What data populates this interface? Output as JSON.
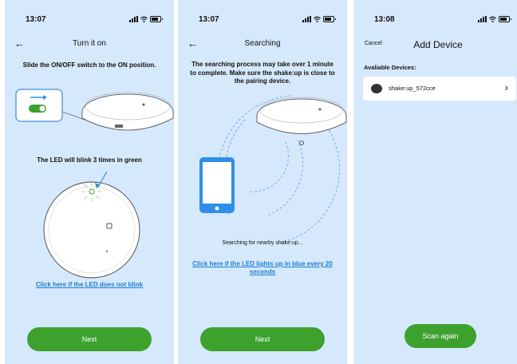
{
  "screens": [
    {
      "status_time": "13:07",
      "nav_title": "Turn it on",
      "instruction": "Slide the ON/OFF switch to the ON position.",
      "led_text": "The LED will blink 3 times in green",
      "help_link": "Click here if the LED does not blink",
      "next_button": "Next"
    },
    {
      "status_time": "13:07",
      "nav_title": "Searching",
      "instruction": "The searching process may take over 1 minute to complete. Make sure the shake:up is close to the pairing device.",
      "searching_text": "Searching for nearby shake:up...",
      "help_link": "Click here if the LED lights up in blue every 20 seconds",
      "next_button": "Next"
    },
    {
      "status_time": "13:08",
      "cancel_label": "Cancel",
      "nav_title": "Add Device",
      "available_label": "Avaliable Devices:",
      "devices": [
        {
          "name": "shake:up_572cce"
        }
      ],
      "scan_button": "Scan again"
    }
  ],
  "colors": {
    "screen_bg": "#d6e8fb",
    "button_green": "#3da12e",
    "link_blue": "#1a7fd4",
    "phone_blue": "#2f8fe8"
  },
  "icons": [
    "back-arrow-icon",
    "signal-icon",
    "wifi-icon",
    "battery-icon",
    "chevron-right-icon",
    "toggle-switch-icon"
  ]
}
